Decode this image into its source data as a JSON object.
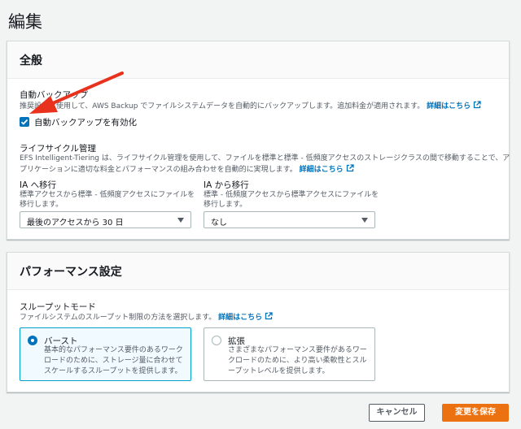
{
  "page": {
    "title": "編集"
  },
  "general": {
    "title": "全般",
    "auto_backup": {
      "label": "自動バックアップ",
      "desc": "推奨設定を使用して、AWS Backup でファイルシステムデータを自動的にバックアップします。追加料金が適用されます。",
      "link": "詳細はこちら",
      "checkbox_label": "自動バックアップを有効化",
      "checked": true
    },
    "lifecycle": {
      "label": "ライフサイクル管理",
      "desc_line1": "EFS Intelligent-Tiering は、ライフサイクル管理を使用して、ファイルを標準と標準 - 低頻度アクセスのストレージクラスの間で移動することで、ア",
      "desc_line2": "プリケーションに適切な料金とパフォーマンスの組み合わせを自動的に実現します。",
      "link": "詳細はこちら"
    },
    "ia_in": {
      "label": "IA へ移行",
      "desc_line1": "標準アクセスから標準 - 低頻度アクセスにファイルを",
      "desc_line2": "移行します。",
      "value": "最後のアクセスから 30 日"
    },
    "ia_out": {
      "label": "IA から移行",
      "desc_line1": "標準 - 低頻度アクセスから標準アクセスにファイルを",
      "desc_line2": "移行します。",
      "value": "なし"
    }
  },
  "performance": {
    "title": "パフォーマンス設定",
    "throughput": {
      "label": "スループットモード",
      "desc": "ファイルシステムのスループット制限の方法を選択します。",
      "link": "詳細はこちら",
      "options": [
        {
          "title": "バースト",
          "desc": "基本的なパフォーマンス要件のあるワークロードのために、ストレージ量に合わせてスケールするスループットを提供します。",
          "selected": true
        },
        {
          "title": "拡張",
          "desc": "さまざまなパフォーマンス要件があるワークロードのために、より高い柔軟性とスループットレベルを提供します。",
          "selected": false
        }
      ]
    }
  },
  "footer": {
    "cancel_label": "キャンセル",
    "save_label": "変更を保存"
  },
  "colors": {
    "accent": "#0073bb",
    "primary_button": "#ec7211",
    "annotation_arrow": "#e8321e"
  }
}
